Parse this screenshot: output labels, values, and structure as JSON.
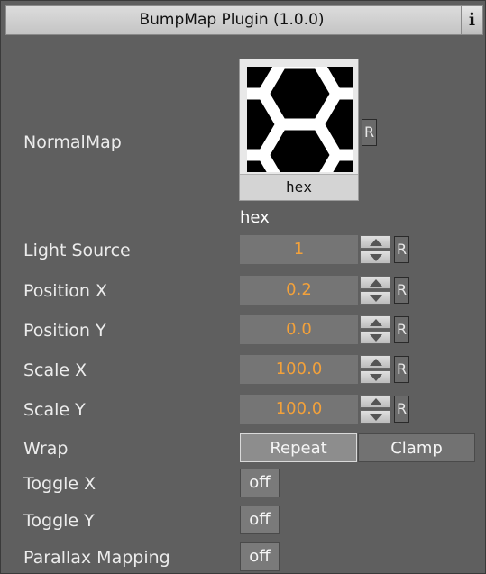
{
  "header": {
    "title": "BumpMap Plugin (1.0.0)",
    "info_label": "i"
  },
  "normal_map": {
    "label": "NormalMap",
    "thumbnail_caption": "hex",
    "texture_name": "hex",
    "reset_label": "R"
  },
  "params": [
    {
      "label": "Light Source",
      "value": "1",
      "reset_label": "R"
    },
    {
      "label": "Position X",
      "value": "0.2",
      "reset_label": "R"
    },
    {
      "label": "Position Y",
      "value": "0.0",
      "reset_label": "R"
    },
    {
      "label": "Scale X",
      "value": "100.0",
      "reset_label": "R"
    },
    {
      "label": "Scale Y",
      "value": "100.0",
      "reset_label": "R"
    }
  ],
  "wrap": {
    "label": "Wrap",
    "options": [
      "Repeat",
      "Clamp"
    ],
    "selected": "Repeat"
  },
  "toggles": [
    {
      "label": "Toggle X",
      "value": "off"
    },
    {
      "label": "Toggle Y",
      "value": "off"
    },
    {
      "label": "Parallax Mapping",
      "value": "off"
    }
  ],
  "colors": {
    "panel_bg": "#5f5f5f",
    "value_text": "#f2a13b",
    "label_text": "#ececec"
  }
}
